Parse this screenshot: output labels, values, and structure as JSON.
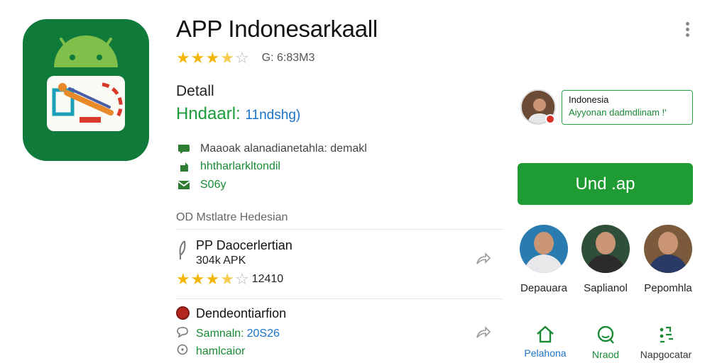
{
  "app": {
    "title": "APP Indonesarkaall",
    "rating_value": 3.5,
    "rating_meta": "G: 6:83M3"
  },
  "details": {
    "heading": "Detall",
    "subtitle_main": "Hndaarl:",
    "subtitle_accent": "11ndshg)",
    "lines": [
      {
        "icon": "chat-icon",
        "text": "Maaoak alanadianetahla: demakl"
      },
      {
        "icon": "bookmark-icon",
        "text": "hhtharlarkltondil"
      },
      {
        "icon": "mail-icon",
        "text": "S06y"
      }
    ]
  },
  "section": {
    "heading": "OD Mstlatre Hedesian"
  },
  "items": [
    {
      "icon": "feather-icon",
      "title": "PP Daocerlertian",
      "size": "304k APK",
      "rating_value": 3.5,
      "rating_count": "12410"
    },
    {
      "title": "Dendeontiarfion",
      "line_a_label": "Samnaln:",
      "line_a_value": "20S26",
      "line_b_text": "hamlcaior"
    }
  ],
  "developer": {
    "name": "Indonesia",
    "subtitle": "Aiyyonan dadmdlinam !'"
  },
  "install_label": "Und .ap",
  "people": [
    {
      "name": "Depauara",
      "shirt": "#e8e8ea",
      "bg": "#2a7bb0",
      "verified": true
    },
    {
      "name": "Saplianol",
      "shirt": "#2b2b2b",
      "bg": "#2f4f3a",
      "verified": false
    },
    {
      "name": "Pepomhla",
      "shirt": "#2a3a66",
      "bg": "#7a5a3a",
      "verified": true
    }
  ],
  "nav": [
    {
      "icon": "home-icon",
      "label": "Pelahona",
      "color": "#1a73c9"
    },
    {
      "icon": "smile-icon",
      "label": "Nraod",
      "color": "#1a8a35"
    },
    {
      "icon": "apps-icon",
      "label": "Napgocatar",
      "color": "#333333"
    }
  ],
  "colors": {
    "brand_green": "#1e9c33",
    "icon_bg": "#0f7a3a",
    "star": "#f2b705",
    "link_blue": "#1a73c9"
  }
}
